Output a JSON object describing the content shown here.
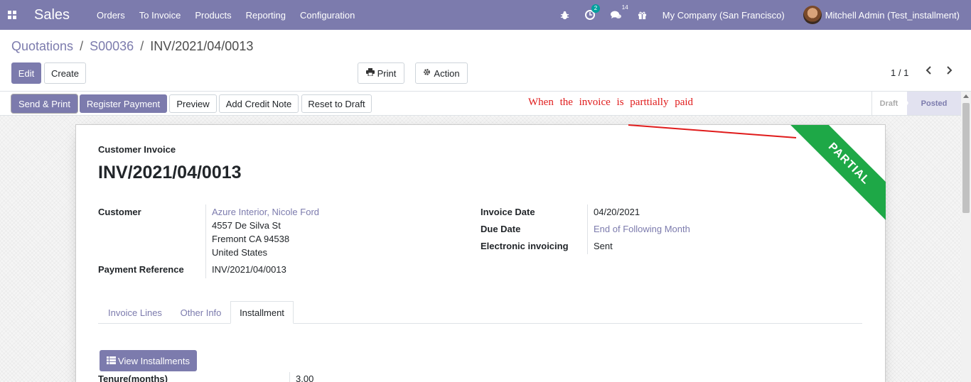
{
  "navbar": {
    "app_name": "Sales",
    "menu": [
      "Orders",
      "To Invoice",
      "Products",
      "Reporting",
      "Configuration"
    ],
    "activity_count": "2",
    "messages_count": "14",
    "company": "My Company (San Francisco)",
    "user": "Mitchell Admin (Test_installment)",
    "color": "#7c7bad"
  },
  "breadcrumb": {
    "first": "Quotations",
    "second": "S00036",
    "current": "INV/2021/04/0013",
    "separator": "/"
  },
  "control": {
    "edit": "Edit",
    "create": "Create",
    "print": "Print",
    "action": "Action",
    "pager": "1 / 1"
  },
  "statusbar": {
    "buttons": [
      "Send & Print",
      "Register Payment",
      "Preview",
      "Add Credit Note",
      "Reset to Draft"
    ],
    "note": "When the invoice is parttially paid",
    "stages": [
      "Draft",
      "Posted"
    ],
    "active_stage": "Posted"
  },
  "invoice": {
    "type_label": "Customer Invoice",
    "number": "INV/2021/04/0013",
    "ribbon": "PARTIAL",
    "ribbon_color": "#1ea847",
    "customer_label": "Customer",
    "customer_name": "Azure Interior, Nicole Ford",
    "address_line1": "4557 De Silva St",
    "address_line2": "Fremont CA 94538",
    "address_line3": "United States",
    "payment_ref_label": "Payment Reference",
    "payment_ref": "INV/2021/04/0013",
    "invoice_date_label": "Invoice Date",
    "invoice_date": "04/20/2021",
    "due_date_label": "Due Date",
    "due_date": "End of Following Month",
    "einvoicing_label": "Electronic invoicing",
    "einvoicing": "Sent"
  },
  "tabs": [
    "Invoice Lines",
    "Other Info",
    "Installment"
  ],
  "active_tab": "Installment",
  "installment": {
    "view_button": "View Installments",
    "tenure_label": "Tenure(months)",
    "tenure_value": "3.00"
  }
}
